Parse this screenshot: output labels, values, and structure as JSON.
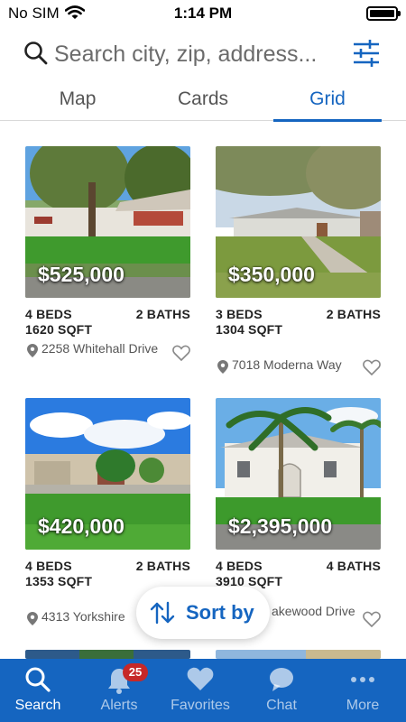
{
  "status_bar": {
    "carrier": "No SIM",
    "time": "1:14 PM"
  },
  "search": {
    "placeholder": "Search city, zip, address..."
  },
  "tabs": [
    {
      "label": "Map"
    },
    {
      "label": "Cards"
    },
    {
      "label": "Grid",
      "selected": true
    }
  ],
  "listings": [
    {
      "price": "$525,000",
      "beds": "4 BEDS",
      "baths": "2 BATHS",
      "sqft": "1620 SQFT",
      "address": "2258 Whitehall Drive"
    },
    {
      "price": "$350,000",
      "beds": "3 BEDS",
      "baths": "2 BATHS",
      "sqft": "1304 SQFT",
      "address": "7018 Moderna Way"
    },
    {
      "price": "$420,000",
      "beds": "4 BEDS",
      "baths": "2 BATHS",
      "sqft": "1353 SQFT",
      "address": "4313 Yorkshire"
    },
    {
      "price": "$2,395,000",
      "beds": "4 BEDS",
      "baths": "4 BATHS",
      "sqft": "3910 SQFT",
      "address": "akewood Drive"
    }
  ],
  "sort_button": {
    "label": "Sort by"
  },
  "tab_bar": {
    "items": [
      {
        "label": "Search",
        "icon": "search-icon",
        "active": true
      },
      {
        "label": "Alerts",
        "icon": "bell-icon",
        "badge": "25"
      },
      {
        "label": "Favorites",
        "icon": "heart-icon"
      },
      {
        "label": "Chat",
        "icon": "chat-bubble-icon"
      },
      {
        "label": "More",
        "icon": "ellipsis-icon"
      }
    ]
  },
  "colors": {
    "accent": "#1565c0",
    "badge": "#c62828"
  }
}
